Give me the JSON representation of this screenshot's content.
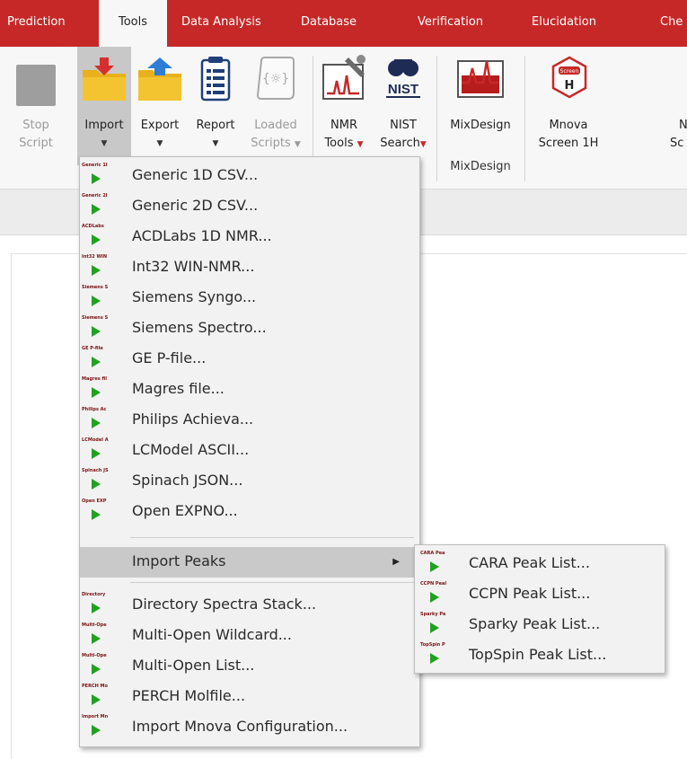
{
  "tabs": [
    {
      "label": "Prediction",
      "active": false
    },
    {
      "label": "Tools",
      "active": true
    },
    {
      "label": "Data Analysis",
      "active": false
    },
    {
      "label": "Database",
      "active": false
    },
    {
      "label": "Verification",
      "active": false
    },
    {
      "label": "Elucidation",
      "active": false
    },
    {
      "label": "Che",
      "active": false
    }
  ],
  "ribbon": {
    "stop": {
      "line1": "Stop",
      "line2": "Script",
      "icon": "stop-icon"
    },
    "import": {
      "line1": "Import",
      "caret": "▼",
      "icon": "folder-import-icon"
    },
    "export": {
      "line1": "Export",
      "caret": "▼",
      "icon": "folder-export-icon"
    },
    "report": {
      "line1": "Report",
      "caret": "▼",
      "icon": "report-icon"
    },
    "loaded": {
      "line1": "Loaded",
      "line2": "Scripts",
      "caret": "▼",
      "icon": "script-icon"
    },
    "nmr": {
      "line1": "NMR",
      "line2": "Tools",
      "caret": "▼",
      "icon": "nmr-tools-icon"
    },
    "nist": {
      "line1": "NIST",
      "line2": "Search",
      "caret": "▼",
      "icon": "nist-icon",
      "badge": "NIST"
    },
    "mixdesign": {
      "line1": "MixDesign",
      "group": "MixDesign",
      "icon": "mixdesign-icon"
    },
    "mnova": {
      "line1": "Mnova",
      "line2": "Screen 1H",
      "icon": "screen-icon",
      "badge": "Screen"
    },
    "partial": {
      "line1": "N",
      "line2": "Sc"
    }
  },
  "import_menu": {
    "items": [
      {
        "label": "Generic 1D CSV...",
        "icon_text": "Generic 1I"
      },
      {
        "label": "Generic 2D CSV...",
        "icon_text": "Generic 2I"
      },
      {
        "label": "ACDLabs 1D NMR...",
        "icon_text": "ACDLabs"
      },
      {
        "label": "Int32 WIN-NMR...",
        "icon_text": "Int32 WIN"
      },
      {
        "label": "Siemens Syngo...",
        "icon_text": "Siemens S"
      },
      {
        "label": "Siemens Spectro...",
        "icon_text": "Siemens S"
      },
      {
        "label": "GE P-file...",
        "icon_text": "GE P-file"
      },
      {
        "label": "Magres file...",
        "icon_text": "Magres fil"
      },
      {
        "label": "Philips Achieva...",
        "icon_text": "Philips Ac"
      },
      {
        "label": "LCModel ASCII...",
        "icon_text": "LCModel A"
      },
      {
        "label": "Spinach JSON...",
        "icon_text": "Spinach JS"
      },
      {
        "label": "Open EXPNO...",
        "icon_text": "Open EXP"
      }
    ],
    "import_peaks": "Import Peaks",
    "submenu_arrow": "▶",
    "items2": [
      {
        "label": "Directory Spectra Stack...",
        "icon_text": "Directory"
      },
      {
        "label": "Multi-Open Wildcard...",
        "icon_text": "Multi-Ope"
      },
      {
        "label": "Multi-Open List...",
        "icon_text": "Multi-Ope"
      },
      {
        "label": "PERCH Molfile...",
        "icon_text": "PERCH Mo"
      },
      {
        "label": "Import Mnova Configuration...",
        "icon_text": "Import Mn"
      }
    ]
  },
  "peaks_submenu": {
    "items": [
      {
        "label": "CARA Peak List...",
        "icon_text": "CARA Pea"
      },
      {
        "label": "CCPN Peak List...",
        "icon_text": "CCPN Peal"
      },
      {
        "label": "Sparky Peak List...",
        "icon_text": "Sparky Pe"
      },
      {
        "label": "TopSpin Peak List...",
        "icon_text": "TopSpin P"
      }
    ]
  },
  "colors": {
    "tab_bar": "#c62828",
    "ribbon_bg": "#f7f7f7",
    "menu_bg": "#f2f2f2",
    "menu_highlight": "#c9c9c9",
    "play_green": "#21a121",
    "folder_yellow": "#f4c430"
  }
}
